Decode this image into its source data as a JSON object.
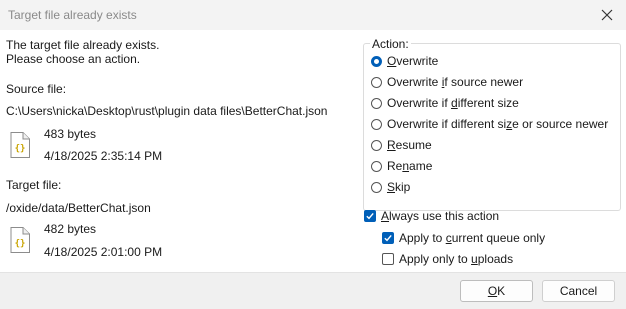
{
  "window": {
    "title": "Target file already exists"
  },
  "message": {
    "line1": "The target file already exists.",
    "line2": "Please choose an action."
  },
  "source": {
    "label": "Source file:",
    "path": "C:\\Users\\nicka\\Desktop\\rust\\plugin data files\\BetterChat.json",
    "size": "483 bytes",
    "date": "4/18/2025 2:35:14 PM",
    "icon": "json-file-icon"
  },
  "target": {
    "label": "Target file:",
    "path": "/oxide/data/BetterChat.json",
    "size": "482 bytes",
    "date": "4/18/2025 2:01:00 PM",
    "icon": "json-file-icon"
  },
  "action": {
    "label": "Action:",
    "selected": "Overwrite",
    "options": [
      {
        "pre": "",
        "key": "O",
        "post": "verwrite"
      },
      {
        "pre": "Overwrite ",
        "key": "i",
        "post": "f source newer"
      },
      {
        "pre": "Overwrite if ",
        "key": "d",
        "post": "ifferent size"
      },
      {
        "pre": "Overwrite if different si",
        "key": "z",
        "post": "e or source newer"
      },
      {
        "pre": "",
        "key": "R",
        "post": "esume"
      },
      {
        "pre": "Re",
        "key": "n",
        "post": "ame"
      },
      {
        "pre": "",
        "key": "S",
        "post": "kip"
      }
    ]
  },
  "checkboxes": {
    "always": {
      "pre": "",
      "key": "A",
      "post": "lways use this action",
      "checked": true
    },
    "queue": {
      "pre": "Apply to ",
      "key": "c",
      "post": "urrent queue only",
      "checked": true
    },
    "uploads": {
      "pre": "Apply only to ",
      "key": "u",
      "post": "ploads",
      "checked": false
    }
  },
  "buttons": {
    "ok": {
      "pre": "",
      "key": "O",
      "post": "K"
    },
    "cancel": "Cancel"
  },
  "colors": {
    "accent": "#005fb8",
    "icon_brace": "#c9a400"
  }
}
